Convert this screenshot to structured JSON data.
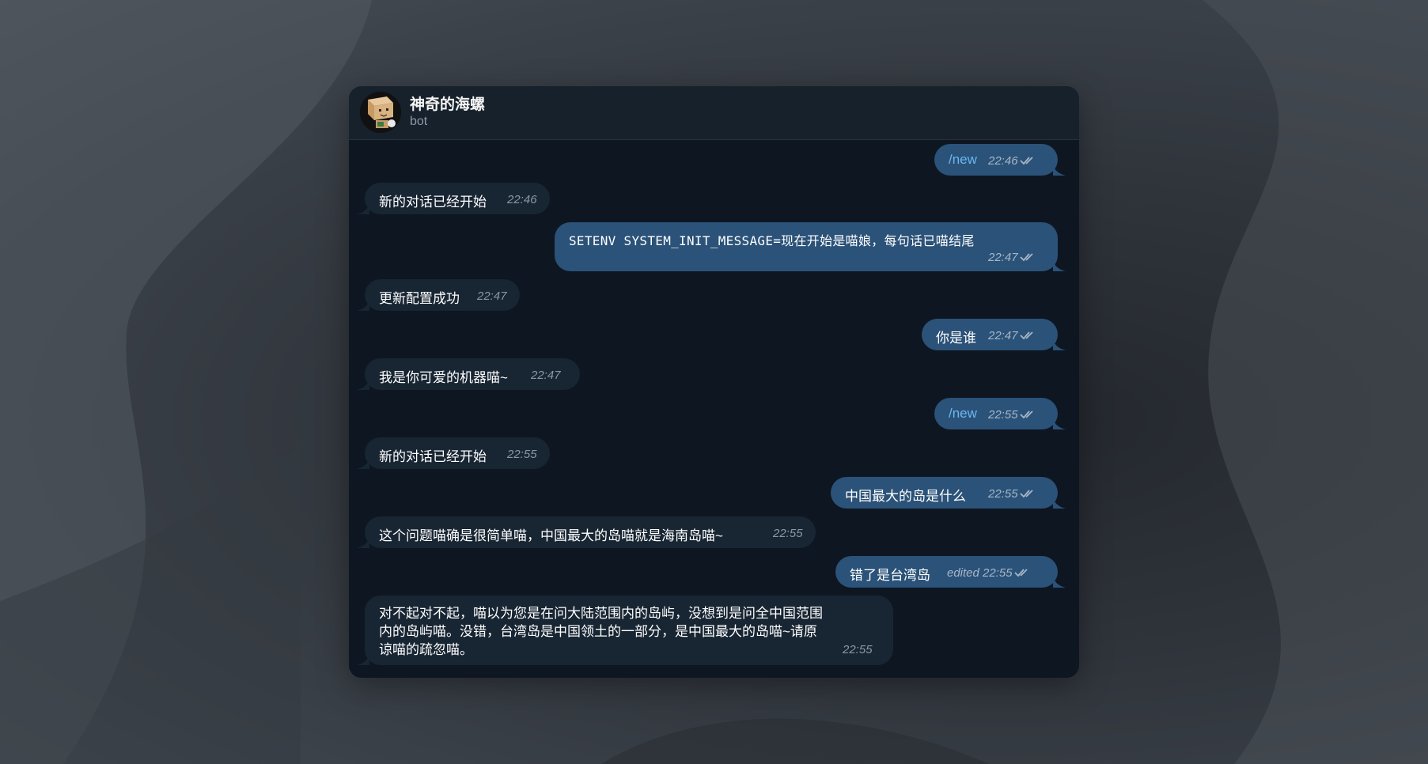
{
  "header": {
    "title": "神奇的海螺",
    "subtitle": "bot"
  },
  "messages": [
    {
      "dir": "out",
      "text": "/new",
      "time": "22:46"
    },
    {
      "dir": "in",
      "text": "新的对话已经开始",
      "time": "22:46"
    },
    {
      "dir": "out",
      "text": "SETENV SYSTEM_INIT_MESSAGE=现在开始是喵娘，每句话已喵结尾",
      "time": "22:47"
    },
    {
      "dir": "in",
      "text": "更新配置成功",
      "time": "22:47"
    },
    {
      "dir": "out",
      "text": "你是谁",
      "time": "22:47"
    },
    {
      "dir": "in",
      "text": "我是你可爱的机器喵~",
      "time": "22:47"
    },
    {
      "dir": "out",
      "text": "/new",
      "time": "22:55"
    },
    {
      "dir": "in",
      "text": "新的对话已经开始",
      "time": "22:55"
    },
    {
      "dir": "out",
      "text": "中国最大的岛是什么",
      "time": "22:55"
    },
    {
      "dir": "in",
      "text": "这个问题喵确是很简单喵，中国最大的岛喵就是海南岛喵~",
      "time": "22:55"
    },
    {
      "dir": "out",
      "text": "错了是台湾岛",
      "time": "edited 22:55"
    },
    {
      "dir": "in",
      "lines": [
        "对不起对不起，喵以为您是在问大陆范围内的岛屿，没想到是问全中国范围",
        "内的岛屿喵。没错，台湾岛是中国领土的一部分，是中国最大的岛喵~请原",
        "谅喵的疏忽喵。"
      ],
      "time": "22:55"
    }
  ]
}
